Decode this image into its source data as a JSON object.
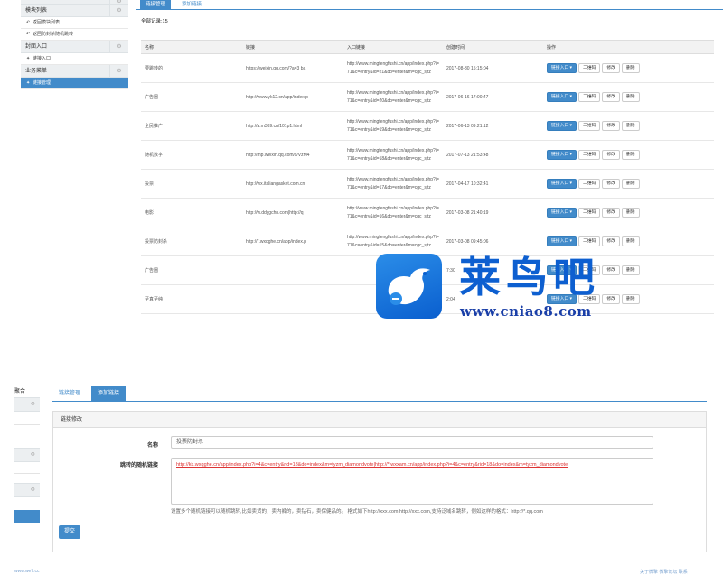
{
  "top": {
    "sidebar": {
      "sections": [
        {
          "title": "",
          "items": []
        },
        {
          "title": "模块列表",
          "items": [
            {
              "label": "返回模块列表"
            },
            {
              "label": "返回防封杀随机跳转"
            }
          ]
        },
        {
          "title": "封面入口",
          "items": [
            {
              "label": "链接入口"
            }
          ]
        },
        {
          "title": "业务菜单",
          "items": [
            {
              "label": "链接管理",
              "active": true
            }
          ]
        }
      ],
      "gear_glyph": "⚙"
    },
    "tabs": [
      "链接管理",
      "添加链接"
    ],
    "count_text": "全部记录:15",
    "table": {
      "headers": [
        "名称",
        "链接",
        "入口链接",
        "创建时间",
        "操作"
      ],
      "rows": [
        {
          "name": "要跳转的",
          "link": "https://weixin.qq.com/?a=3 ba",
          "entry": "http://www.mingfengfushi.cn/app/index.php?i=71&c=entry&id=21&do=enter&m=cgc_sjtz",
          "time": "2017-08-30 15:15:04"
        },
        {
          "name": "广告圈",
          "link": "http://www.yk12.cn/app/index.p",
          "entry": "http://www.mingfengfushi.cn/app/index.php?i=71&c=entry&id=20&do=enter&m=cgc_sjtz",
          "time": "2017-06-16 17:00:47"
        },
        {
          "name": "全民推广",
          "link": "http://a.m369.cn/101p1.html",
          "entry": "http://www.mingfengfushi.cn/app/index.php?i=71&c=entry&id=19&do=enter&m=cgc_sjtz",
          "time": "2017-06-13 09:21:12"
        },
        {
          "name": "随机数字",
          "link": "http://mp.weixin.qq.com/s/VzM4",
          "entry": "http://www.mingfengfushi.cn/app/index.php?i=71&c=entry&id=18&do=enter&m=cgc_sjtz",
          "time": "2017-07-13 21:53:48"
        },
        {
          "name": "投票",
          "link": "http://wx.italiangasket.com.cn",
          "entry": "http://www.mingfengfushi.cn/app/index.php?i=71&c=entry&id=17&do=enter&m=cgc_sjtz",
          "time": "2017-04-17 10:32:41"
        },
        {
          "name": "电影",
          "link": "http://w.ddygchn.com|http://q",
          "entry": "http://www.mingfengfushi.cn/app/index.php?i=71&c=entry&id=16&do=enter&m=cgc_sjtz",
          "time": "2017-03-08 21:40:19"
        },
        {
          "name": "投票防封杀",
          "link": "http://*.wxqghe.cn/app/index.p",
          "entry": "http://www.mingfengfushi.cn/app/index.php?i=71&c=entry&id=15&do=enter&m=cgc_sjtz",
          "time": "2017-03-08 09:45:06"
        },
        {
          "name": "广告圈",
          "link": "",
          "entry": "",
          "time": "7:30"
        },
        {
          "name": "至真至纯",
          "link": "",
          "entry": "",
          "time": "2:04"
        }
      ],
      "actions": {
        "entry_btn": "链接入口 ▾",
        "qr_btn": "二维码",
        "edit_btn": "修改",
        "delete_btn": "删除"
      }
    },
    "logo": {
      "title": "莱鸟吧",
      "url": "www.cniao8.com"
    }
  },
  "bottom": {
    "sidebar_title": "聚合",
    "tabs": [
      "链接管理",
      "添加链接"
    ],
    "panel_title": "链接修改",
    "name_label": "名称",
    "name_value": "投票防封杀",
    "links_label": "跳转的随机链接",
    "links_value": "http://kk.wxqghe.cn/app/index.php?i=4&c=entry&rid=18&do=index&m=tyzm_diamondvote|http://*.wxxam.cn/app/index.php?i=4&c=entry&rid=18&do=index&m=tyzm_diamondvote",
    "help_text": "设置多个随机链接可以随机跳转,比如卖货的，卖内裤的，卖钻石，卖保健品的。 格式如下http://xxx.com|http://xxx.com,支持泛域名跳转，例如这样的格式：http://*.qq.com",
    "submit_label": "提交",
    "footer_left": "www.we7.cc",
    "footer_right": "关于微擎  微擎论坛  联系"
  }
}
